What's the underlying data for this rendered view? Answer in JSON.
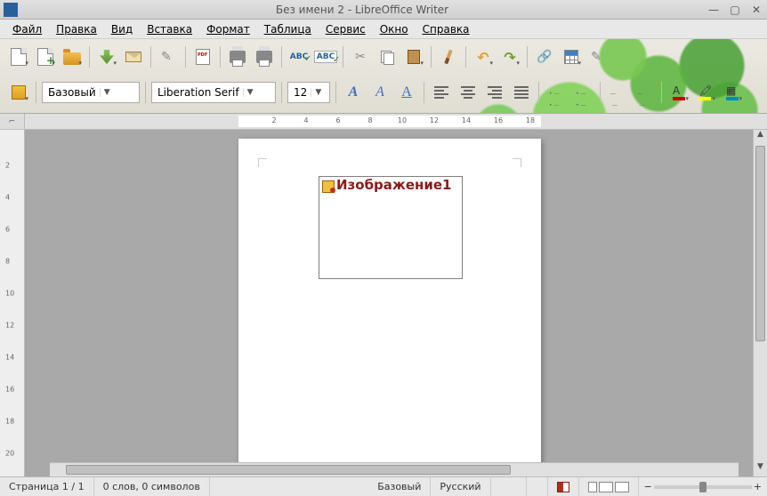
{
  "window": {
    "title": "Без имени 2 - LibreOffice Writer"
  },
  "menu": {
    "file": "Файл",
    "edit": "Правка",
    "view": "Вид",
    "insert": "Вставка",
    "format": "Формат",
    "table": "Таблица",
    "tools": "Сервис",
    "window": "Окно",
    "help": "Справка"
  },
  "toolbar2": {
    "paragraph_style": "Базовый",
    "font_name": "Liberation Serif",
    "font_size": "12"
  },
  "ruler": {
    "labels": [
      "2",
      "4",
      "6",
      "8",
      "10",
      "12",
      "14",
      "16",
      "18"
    ]
  },
  "vruler": {
    "labels": [
      "2",
      "4",
      "6",
      "8",
      "10",
      "12",
      "14",
      "16",
      "18",
      "20"
    ]
  },
  "document": {
    "frame_caption": "Изображение1"
  },
  "statusbar": {
    "page": "Страница 1 / 1",
    "words": "0 слов, 0 символов",
    "style": "Базовый",
    "language": "Русский",
    "zoom_minus": "−",
    "zoom_plus": "+"
  }
}
